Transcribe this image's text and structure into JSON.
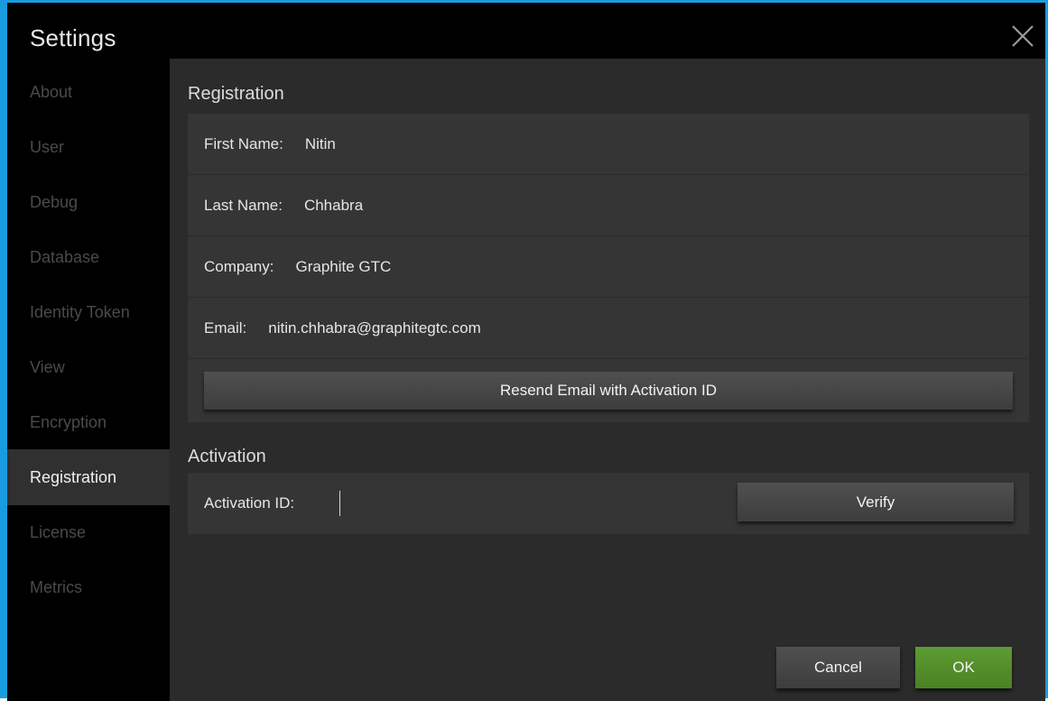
{
  "window": {
    "title": "Settings"
  },
  "sidebar": {
    "items": [
      {
        "label": "About"
      },
      {
        "label": "User"
      },
      {
        "label": "Debug"
      },
      {
        "label": "Database"
      },
      {
        "label": "Identity Token"
      },
      {
        "label": "View"
      },
      {
        "label": "Encryption"
      },
      {
        "label": "Registration"
      },
      {
        "label": "License"
      },
      {
        "label": "Metrics"
      }
    ],
    "active": "Registration"
  },
  "registration": {
    "title": "Registration",
    "fields": [
      {
        "label": "First Name:",
        "value": "Nitin"
      },
      {
        "label": "Last Name:",
        "value": "Chhabra"
      },
      {
        "label": "Company:",
        "value": "Graphite GTC"
      },
      {
        "label": "Email:",
        "value": "nitin.chhabra@graphitegtc.com"
      }
    ],
    "resend_button": "Resend Email with Activation ID"
  },
  "activation": {
    "title": "Activation",
    "id_label": "Activation ID:",
    "id_value": "",
    "verify_button": "Verify"
  },
  "footer": {
    "cancel_label": "Cancel",
    "ok_label": "OK"
  },
  "colors": {
    "accent_border": "#1a9be0",
    "ok_button": "#4f8a27",
    "content_bg": "#2b2b2b",
    "panel_bg": "#353535"
  }
}
